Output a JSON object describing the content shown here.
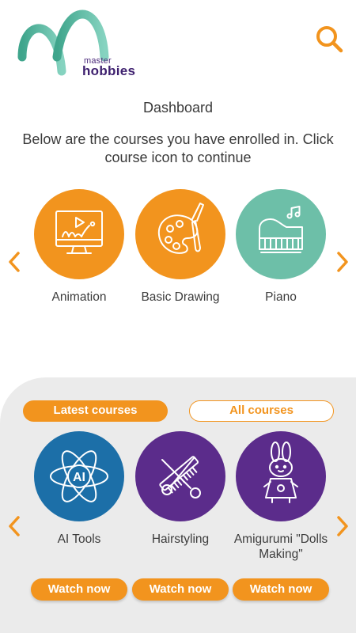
{
  "header": {
    "logo_small": "master",
    "logo_big": "hobbies",
    "search_icon": "search-icon"
  },
  "dashboard": {
    "title": "Dashboard",
    "intro": "Below are the courses you have enrolled in. Click course icon to continue",
    "courses": [
      {
        "label": "Animation",
        "icon": "animation-monitor-icon",
        "color": "#f2941e"
      },
      {
        "label": "Basic Drawing",
        "icon": "palette-brush-icon",
        "color": "#f2941e"
      },
      {
        "label": "Piano",
        "icon": "piano-icon",
        "color": "#6dbfa8"
      }
    ]
  },
  "latest": {
    "tab_latest": "Latest courses",
    "tab_all": "All courses",
    "courses": [
      {
        "label": "AI Tools",
        "icon": "ai-atom-icon",
        "color": "#1c6fa8",
        "action": "Watch now"
      },
      {
        "label": "Hairstyling",
        "icon": "scissors-comb-icon",
        "color": "#5b2c8b",
        "action": "Watch now"
      },
      {
        "label": "Amigurumi \"Dolls Making\"",
        "icon": "bunny-doll-icon",
        "color": "#5b2c8b",
        "action": "Watch now"
      }
    ]
  },
  "colors": {
    "accent": "#f2941e",
    "teal": "#6dbfa8",
    "brand_purple": "#3d1f6e",
    "panel_bg": "#ebebeb"
  }
}
